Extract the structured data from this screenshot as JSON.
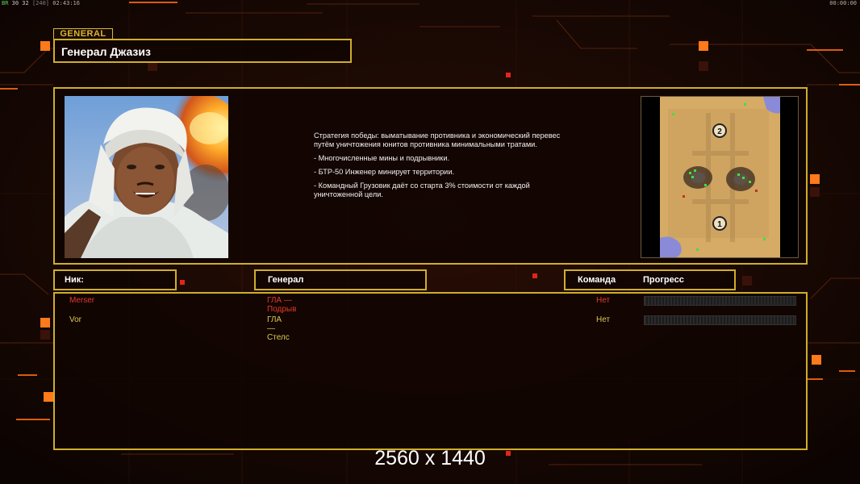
{
  "hud": {
    "left_prefix": "BR",
    "left_values": "30 32",
    "left_bracket": "[240]",
    "left_time": "02:43:16",
    "right_time": "00:00:00"
  },
  "header": {
    "tag": "GENERAL",
    "title": "Генерал Джазиз"
  },
  "general": {
    "portrait_icon": "general-portrait",
    "description": [
      "Стратегия победы: выматывание противника и экономический перевес путём уничтожения юнитов противника минимальными тратами.",
      "- Многочисленные мины и подрывники.",
      "- БТР-50 Инженер минирует территории.",
      "- Командный Грузовик даёт со старта 3% стоимости от каждой уничтоженной цели."
    ]
  },
  "minimap": {
    "start_labels": [
      "2",
      "1"
    ]
  },
  "table": {
    "col_nick": "Ник:",
    "col_general": "Генерал",
    "col_team": "Команда",
    "col_progress": "Прогресс"
  },
  "players": [
    {
      "nick": "Merser",
      "general": "ГЛА — Подрыв",
      "team": "Нет",
      "color": "#e53a2a",
      "progress": 0
    },
    {
      "nick": "Vor",
      "general": "ГЛА — Стелс",
      "team": "Нет",
      "color": "#dcc850",
      "progress": 0
    }
  ],
  "watermark": "2560 x 1440",
  "colors": {
    "frame": "#cfae2a",
    "accent_orange": "#ff7a1a",
    "player_red": "#e53a2a",
    "player_yellow": "#dcc850"
  }
}
